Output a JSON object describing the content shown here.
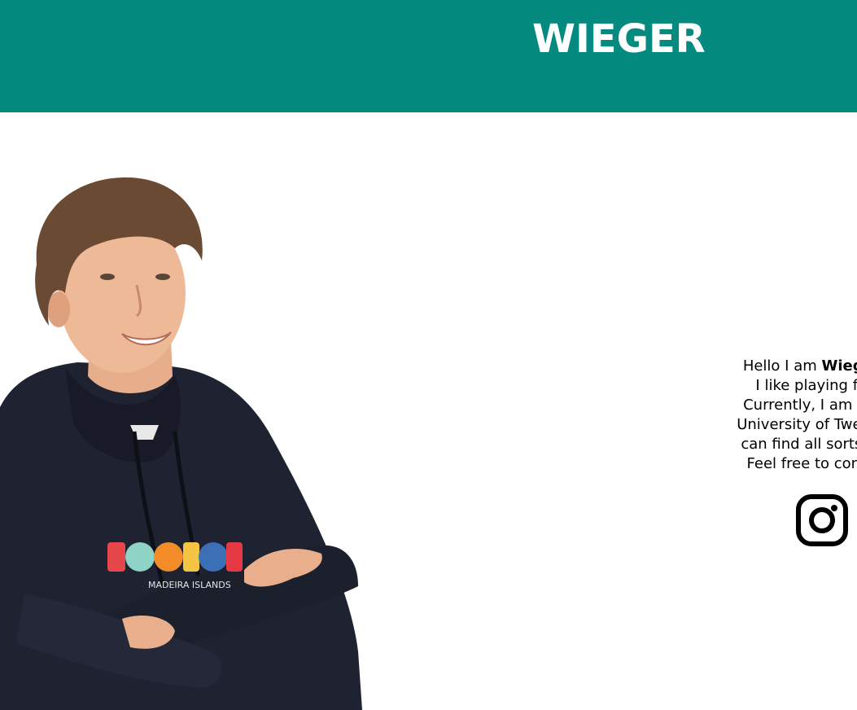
{
  "header": {
    "title": "WIEGER",
    "background_color": "#058A80",
    "text_color": "#FFFFFF"
  },
  "profile_photo": {
    "alt": "Portrait of Wieger smiling with crossed arms",
    "shirt_print": "MADEIRA ISLANDS"
  },
  "bio": {
    "line1_prefix": "Hello I am ",
    "line1_name": "Wieger Witt",
    "line2": "I like playing football",
    "line3": "Currently, I am studying",
    "line4": "University of Twente in En",
    "line5": "can find all sorts of proje",
    "line6": "Feel free to contact me"
  },
  "social": {
    "instagram_icon": "instagram-icon"
  }
}
